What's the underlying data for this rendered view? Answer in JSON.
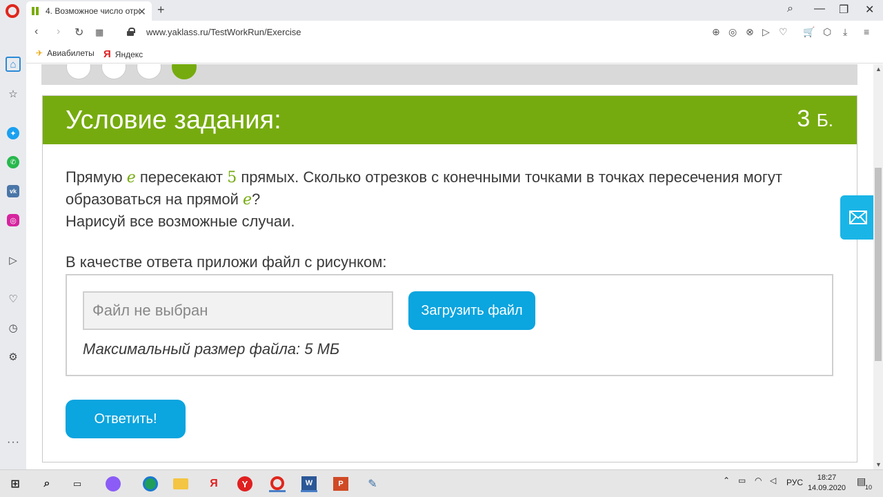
{
  "browser": {
    "tab_title": "4. Возможное число отре",
    "url": "www.yaklass.ru/TestWorkRun/Exercise",
    "bookmarks": [
      {
        "label": "Авиабилеты",
        "icon": "plane-icon"
      },
      {
        "label": "Яндекс",
        "icon": "yandex-icon"
      }
    ]
  },
  "card": {
    "title": "Условие задания:",
    "points_value": "3",
    "points_unit": "Б.",
    "task_part1": "Прямую ",
    "var_e": "e",
    "task_part2": " пересекают ",
    "num_5": "5",
    "task_part3": " прямых. Сколько отрезков с конечными точками в точках пересечения могут образоваться на прямой ",
    "var_e2": "e",
    "task_part4": "?",
    "task_line2": "Нарисуй все возможные случаи.",
    "attach_label": "В качестве ответа приложи файл с рисунком:",
    "file_placeholder": "Файл не выбран",
    "upload_button": "Загрузить файл",
    "max_size_text": "Максимальный размер файла: 5 МБ",
    "answer_button": "Ответить!"
  },
  "taskbar": {
    "language": "РУС",
    "time": "18:27",
    "date": "14.09.2020",
    "notifications": "10"
  },
  "colors": {
    "header_green": "#76ab0f",
    "button_blue": "#0ba5df"
  }
}
